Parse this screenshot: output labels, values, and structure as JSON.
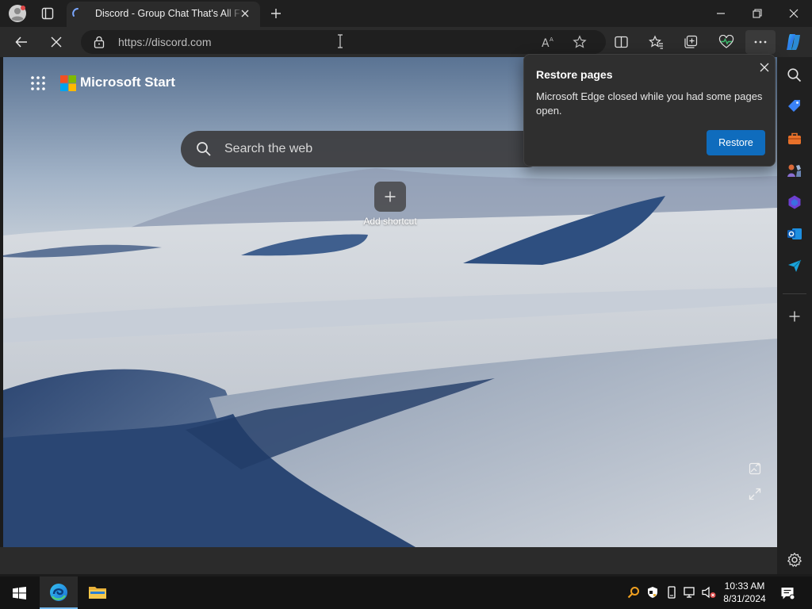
{
  "browser": {
    "tab": {
      "title": "Discord - Group Chat That's All Fun & Games"
    },
    "address_bar": {
      "url": "https://discord.com"
    }
  },
  "new_tab_page": {
    "brand": "Microsoft Start",
    "search": {
      "placeholder": "Search the web"
    },
    "add_shortcut_label": "Add shortcut"
  },
  "restore_popup": {
    "title": "Restore pages",
    "message": "Microsoft Edge closed while you had some pages open.",
    "restore_label": "Restore"
  },
  "taskbar": {
    "time": "10:33 AM",
    "date": "8/31/2024"
  },
  "colors": {
    "accent": "#0f6cbd",
    "microsoft_logo": [
      "#f25022",
      "#7fba00",
      "#00a4ef",
      "#ffb900"
    ]
  },
  "icons": {
    "titlebar": [
      "profile-icon",
      "tab-actions-icon",
      "loading-spinner-icon",
      "close-icon",
      "new-tab-icon"
    ],
    "toolbar": [
      "back-icon",
      "stop-icon",
      "lock-icon",
      "read-aloud-icon",
      "favorite-icon",
      "split-screen-icon",
      "favorites-icon",
      "collections-icon",
      "browser-essentials-icon",
      "more-icon",
      "copilot-icon"
    ],
    "sidebar": [
      "search-icon",
      "shopping-icon",
      "tools-icon",
      "games-icon",
      "office-icon",
      "outlook-icon",
      "drop-icon",
      "add-icon",
      "settings-icon"
    ]
  }
}
